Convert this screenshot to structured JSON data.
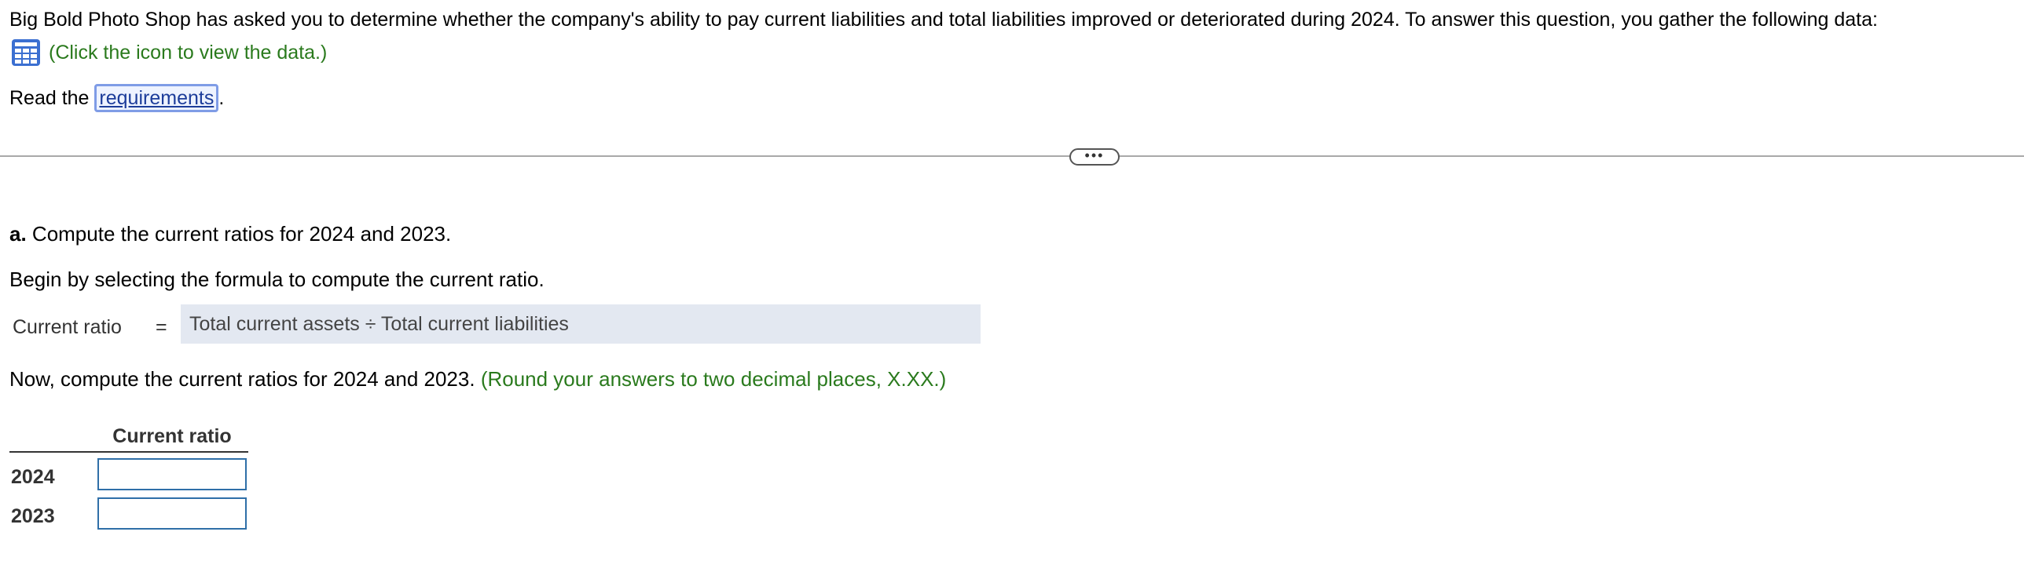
{
  "intro_text": "Big Bold Photo Shop has asked you to determine whether the company's ability to pay current liabilities and total liabilities improved or deteriorated during 2024. To answer this question, you gather the following data:",
  "data_link_text": "(Click the icon to view the data.)",
  "data_icon": "table-grid-icon",
  "read_prefix": "Read the ",
  "requirements_link": "requirements",
  "read_suffix": ".",
  "expand_handle_text": "•••",
  "part_a": {
    "label": "a.",
    "text": " Compute the current ratios for 2024 and 2023."
  },
  "begin_text": "Begin by selecting the formula to compute the current ratio.",
  "formula": {
    "label": "Current ratio",
    "equals": "=",
    "value": "Total current assets ÷ Total current liabilities"
  },
  "now_text": "Now, compute the current ratios for 2024 and 2023. ",
  "round_note": "(Round your answers to two decimal places, X.XX.)",
  "ratio_table": {
    "header": "Current ratio",
    "rows": [
      {
        "year": "2024",
        "value": ""
      },
      {
        "year": "2023",
        "value": ""
      }
    ]
  },
  "colors": {
    "green_note": "#2a7a1d",
    "link_blue": "#1d3d9a",
    "input_border": "#2f6fa8",
    "formula_bg": "#e3e8f1",
    "icon_blue": "#3b6fd1"
  }
}
